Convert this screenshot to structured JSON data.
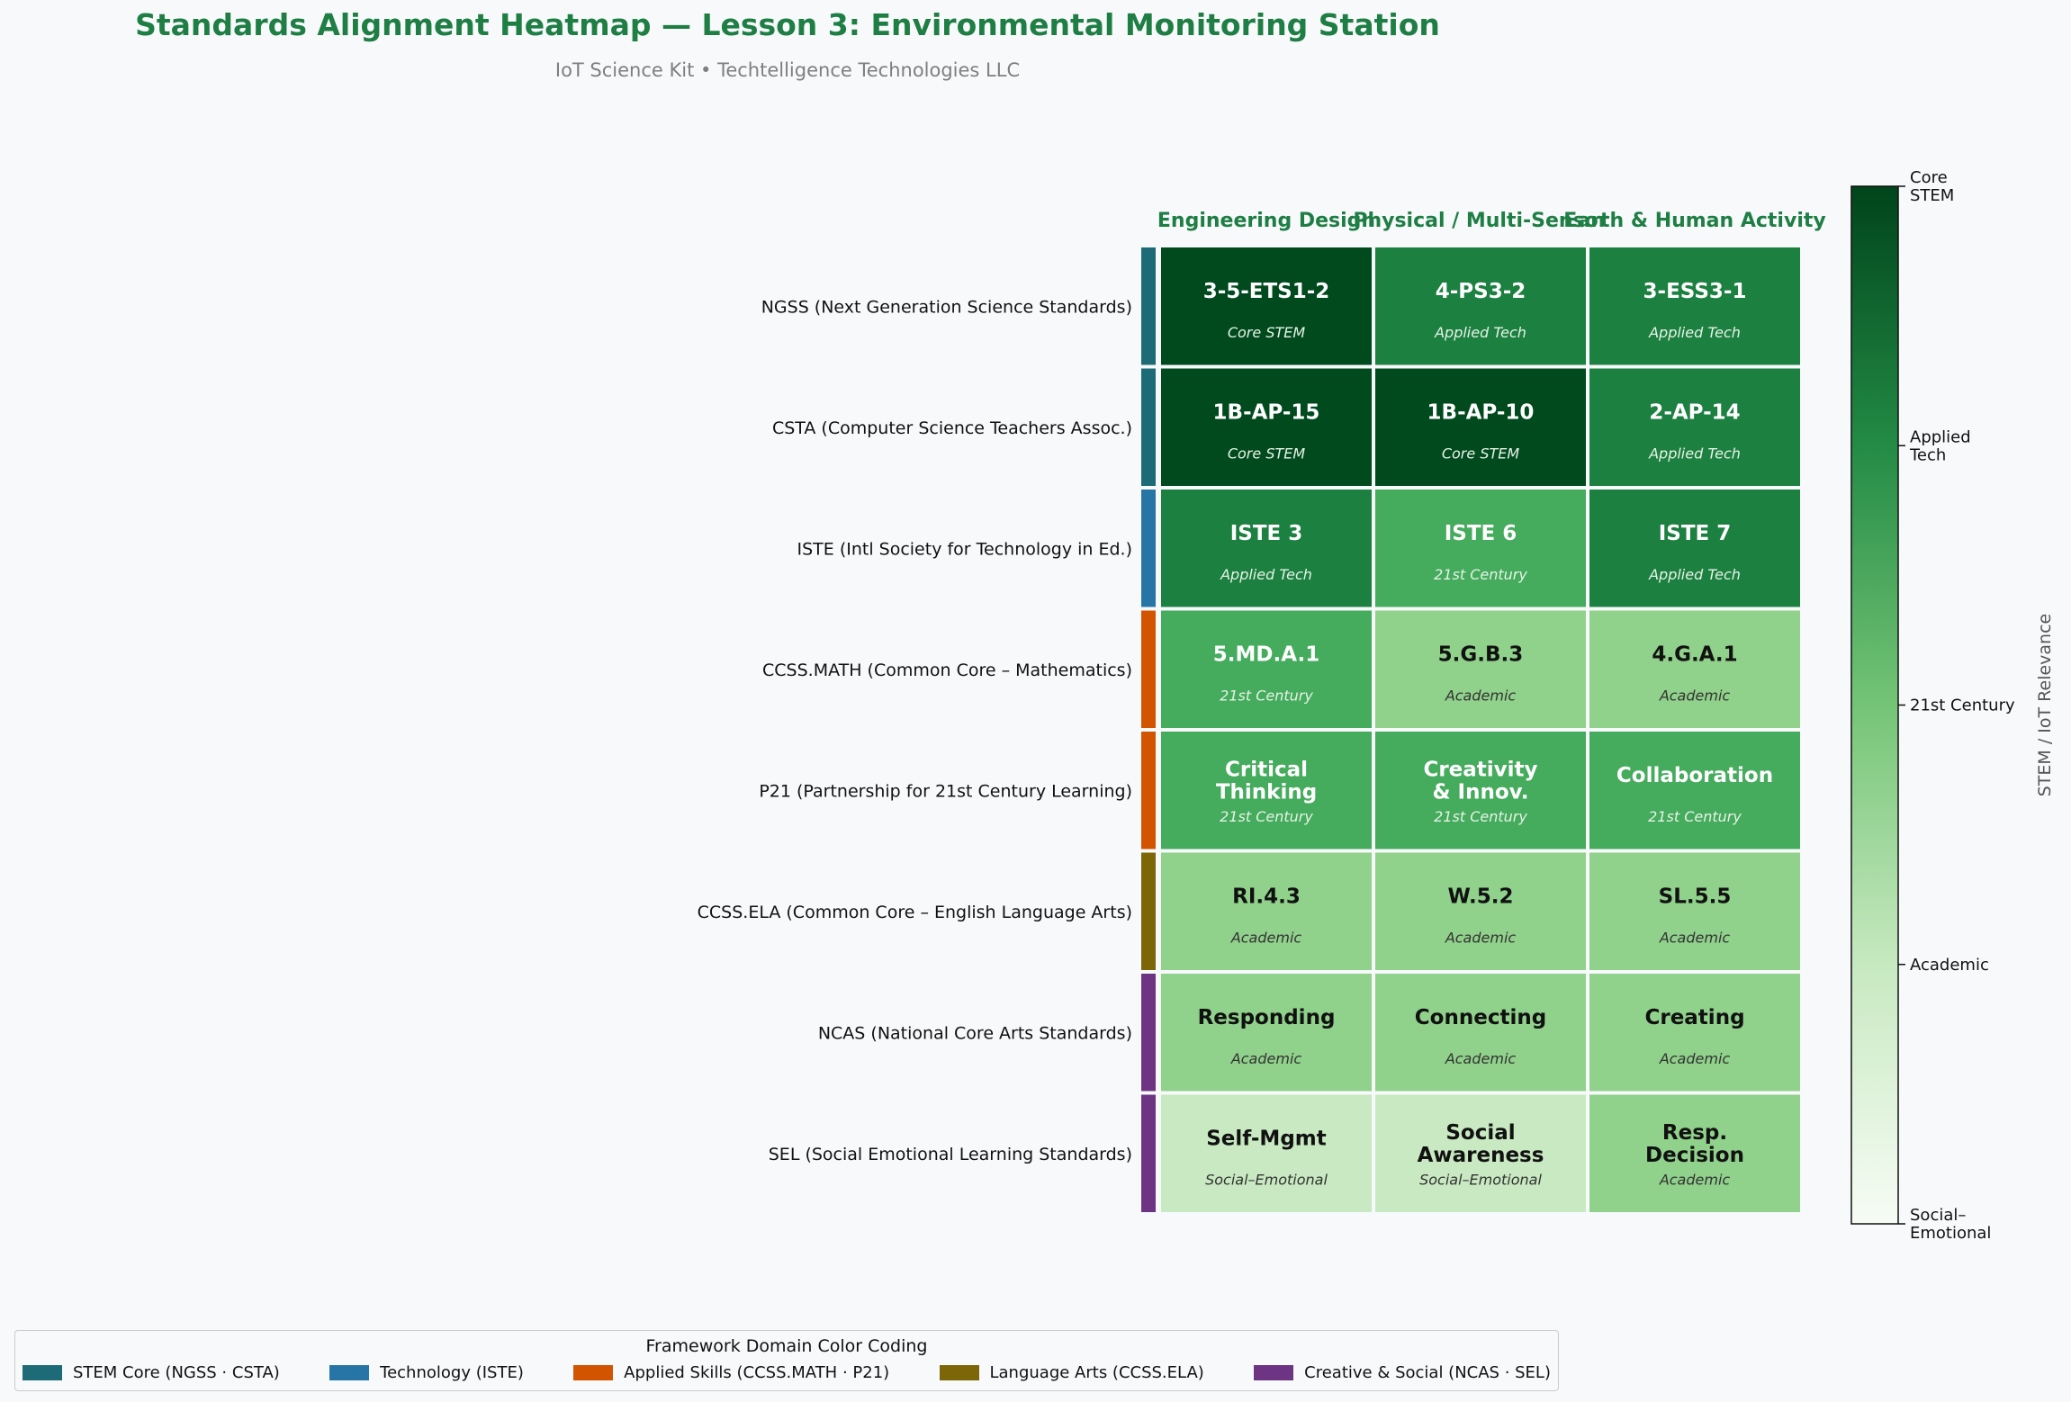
{
  "title": "Standards Alignment Heatmap — Lesson 3: Environmental Monitoring Station",
  "subtitle": "IoT Science Kit  •  Techtelligence Technologies LLC",
  "chart_data": {
    "type": "heatmap",
    "columns": [
      "Engineering Design",
      "Physical / Multi-Sensor",
      "Earth & Human Activity"
    ],
    "rows": [
      {
        "label": "NGSS  (Next Generation Science Standards)",
        "domain": "stem",
        "cells": [
          {
            "code": "3-5-ETS1-2",
            "level": "Core STEM",
            "value": 4
          },
          {
            "code": "4-PS3-2",
            "level": "Applied Tech",
            "value": 3
          },
          {
            "code": "3-ESS3-1",
            "level": "Applied Tech",
            "value": 3
          }
        ]
      },
      {
        "label": "CSTA  (Computer Science Teachers Assoc.)",
        "domain": "stem",
        "cells": [
          {
            "code": "1B-AP-15",
            "level": "Core STEM",
            "value": 4
          },
          {
            "code": "1B-AP-10",
            "level": "Core STEM",
            "value": 4
          },
          {
            "code": "2-AP-14",
            "level": "Applied Tech",
            "value": 3
          }
        ]
      },
      {
        "label": "ISTE  (Intl Society for Technology in Ed.)",
        "domain": "tech",
        "cells": [
          {
            "code": "ISTE 3",
            "level": "Applied Tech",
            "value": 3
          },
          {
            "code": "ISTE 6",
            "level": "21st Century",
            "value": 2
          },
          {
            "code": "ISTE 7",
            "level": "Applied Tech",
            "value": 3
          }
        ]
      },
      {
        "label": "CCSS.MATH  (Common Core – Mathematics)",
        "domain": "applied",
        "cells": [
          {
            "code": "5.MD.A.1",
            "level": "21st Century",
            "value": 2
          },
          {
            "code": "5.G.B.3",
            "level": "Academic",
            "value": 1
          },
          {
            "code": "4.G.A.1",
            "level": "Academic",
            "value": 1
          }
        ]
      },
      {
        "label": "P21  (Partnership for 21st Century Learning)",
        "domain": "applied",
        "cells": [
          {
            "code": "Critical\nThinking",
            "level": "21st Century",
            "value": 2
          },
          {
            "code": "Creativity\n& Innov.",
            "level": "21st Century",
            "value": 2
          },
          {
            "code": "Collaboration",
            "level": "21st Century",
            "value": 2
          }
        ]
      },
      {
        "label": "CCSS.ELA  (Common Core – English Language Arts)",
        "domain": "language",
        "cells": [
          {
            "code": "RI.4.3",
            "level": "Academic",
            "value": 1
          },
          {
            "code": "W.5.2",
            "level": "Academic",
            "value": 1
          },
          {
            "code": "SL.5.5",
            "level": "Academic",
            "value": 1
          }
        ]
      },
      {
        "label": "NCAS  (National Core Arts Standards)",
        "domain": "creative",
        "cells": [
          {
            "code": "Responding",
            "level": "Academic",
            "value": 1
          },
          {
            "code": "Connecting",
            "level": "Academic",
            "value": 1
          },
          {
            "code": "Creating",
            "level": "Academic",
            "value": 1
          }
        ]
      },
      {
        "label": "SEL  (Social Emotional Learning Standards)",
        "domain": "creative",
        "cells": [
          {
            "code": "Self-Mgmt",
            "level": "Social–Emotional",
            "value": 0
          },
          {
            "code": "Social\nAwareness",
            "level": "Social–Emotional",
            "value": 0
          },
          {
            "code": "Resp.\nDecision",
            "level": "Academic",
            "value": 1
          }
        ]
      }
    ],
    "colorbar": {
      "label": "STEM / IoT Relevance",
      "range": [
        0,
        4
      ],
      "ticks": [
        {
          "value": 4,
          "label": "Core\nSTEM"
        },
        {
          "value": 3,
          "label": "Applied\nTech"
        },
        {
          "value": 2,
          "label": "21st Century"
        },
        {
          "value": 1,
          "label": "Academic"
        },
        {
          "value": 0,
          "label": "Social–\nEmotional"
        }
      ]
    },
    "level_colors": {
      "4": "#004a1e",
      "3": "#1c8040",
      "2": "#45ab5d",
      "1": "#90d18b",
      "0": "#c8e9c1"
    },
    "domain_colors": {
      "stem": "#1e6b78",
      "tech": "#2775a6",
      "applied": "#d35400",
      "language": "#7d6608",
      "creative": "#6c3483"
    }
  },
  "legend": {
    "title": "Framework Domain Color Coding",
    "items": [
      {
        "label": "STEM Core  (NGSS · CSTA)",
        "color": "#1e6b78"
      },
      {
        "label": "Technology  (ISTE)",
        "color": "#2775a6"
      },
      {
        "label": "Applied Skills  (CCSS.MATH · P21)",
        "color": "#d35400"
      },
      {
        "label": "Language Arts  (CCSS.ELA)",
        "color": "#7d6608"
      },
      {
        "label": "Creative & Social  (NCAS · SEL)",
        "color": "#6c3483"
      }
    ]
  }
}
